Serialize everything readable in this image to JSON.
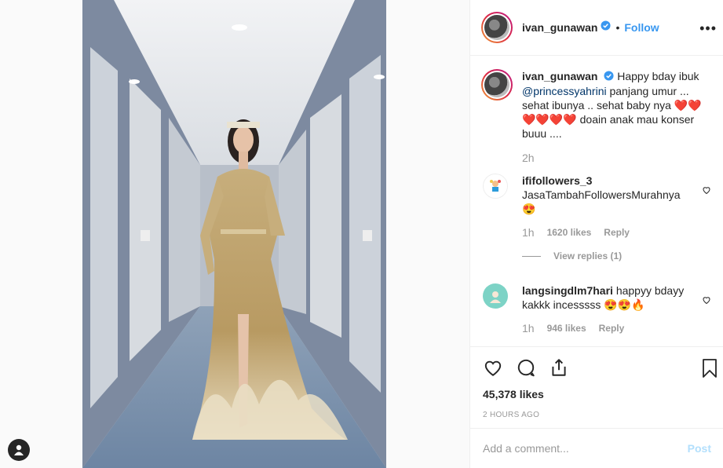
{
  "post": {
    "username": "ivan_gunawan",
    "follow_label": "Follow",
    "more_label": "•••",
    "caption_username": "ivan_gunawan",
    "caption_pre": "Happy bday ibuk",
    "caption_mention": "@princessyahrini",
    "caption_mid": "panjang umur ... sehat ibunya .. sehat baby nya",
    "caption_hearts_1": "❤️❤️",
    "caption_hearts_2": "❤️❤️❤️❤️",
    "caption_end": "doain anak mau konser buuu ....",
    "caption_time": "2h",
    "likes": "45,378 likes",
    "posted_ago": "2 HOURS AGO"
  },
  "comments": [
    {
      "username": "ififollowers_3",
      "text": "JasaTambahFollowersMurahnya",
      "emoji": "😍",
      "time": "1h",
      "likes": "1620 likes",
      "reply_label": "Reply",
      "view_replies": "View replies (1)"
    },
    {
      "username": "langsingdlm7hari",
      "text": "happyy bdayy kakkk incesssss",
      "emoji": "😍😍🔥",
      "time": "1h",
      "likes": "946 likes",
      "reply_label": "Reply"
    }
  ],
  "add_comment": {
    "placeholder": "Add a comment...",
    "post_label": "Post"
  },
  "colors": {
    "link": "#3897f0",
    "heart": "#ed4956"
  }
}
